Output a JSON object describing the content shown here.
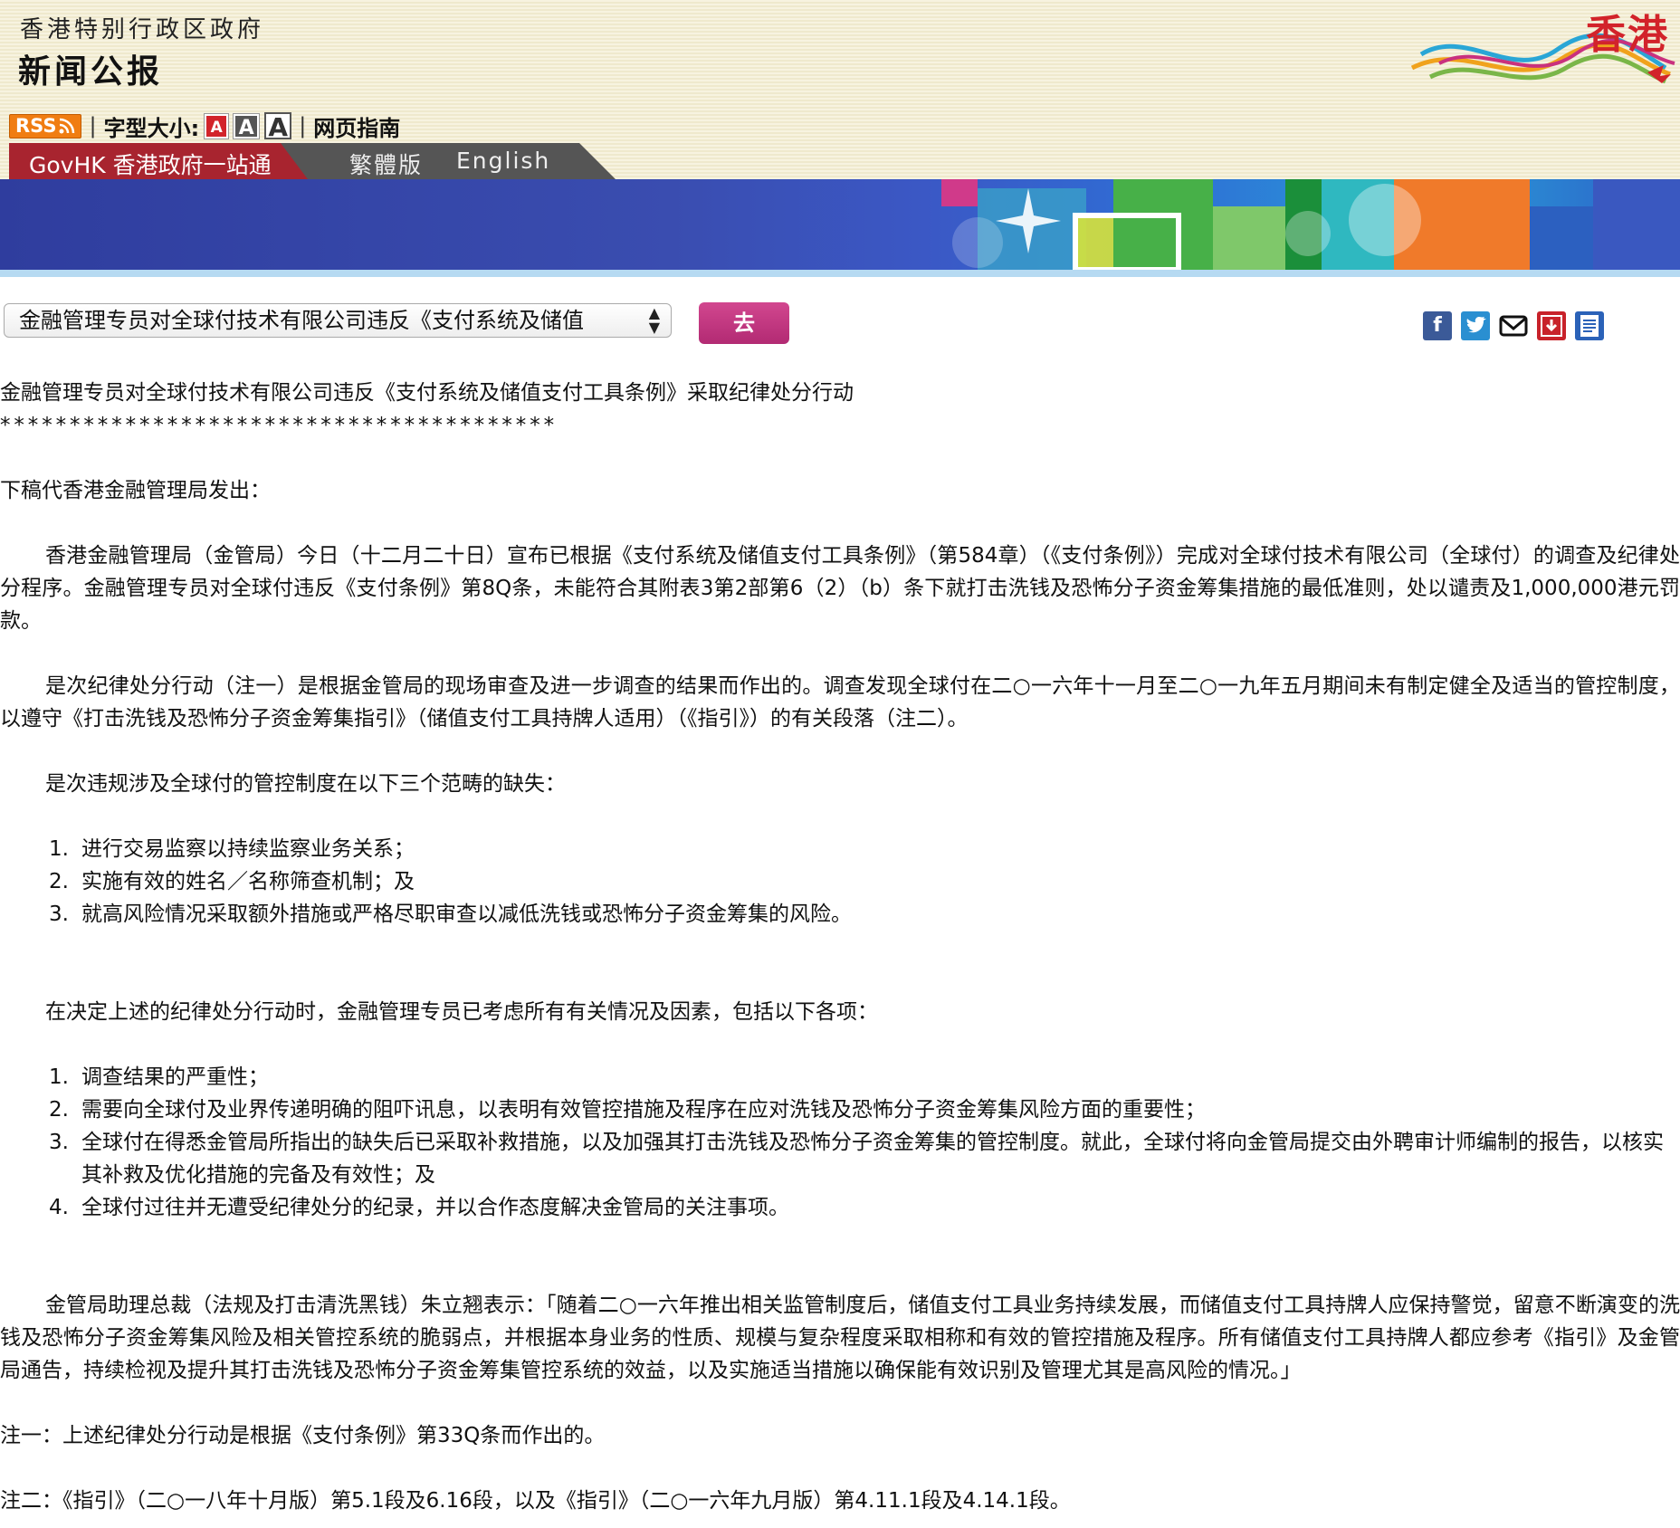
{
  "header": {
    "gov_name": "香港特别行政区政府",
    "press_title": "新闻公报",
    "brand": "香港",
    "rss_label": "RSS",
    "font_size_label": "字型大小:",
    "font_sizes": [
      "A",
      "A",
      "A"
    ],
    "guide_label": "网页指南"
  },
  "nav": {
    "govhk": "GovHK 香港政府一站通",
    "traditional": "繁體版",
    "english": "English"
  },
  "controls": {
    "select_value": "金融管理专员对全球付技术有限公司违反《支付系统及储值",
    "go_label": "去"
  },
  "share_icons": [
    "facebook-icon",
    "twitter-icon",
    "email-icon",
    "download-icon",
    "print-icon"
  ],
  "article": {
    "title": "金融管理专员对全球付技术有限公司违反《支付系统及储值支付工具条例》采取纪律处分行动",
    "stars": "****************************************",
    "intro": "下稿代香港金融管理局发出：",
    "p1": "香港金融管理局（金管局）今日（十二月二十日）宣布已根据《支付系统及储值支付工具条例》（第584章）（《支付条例》）完成对全球付技术有限公司（全球付）的调查及纪律处分程序。金融管理专员对全球付违反《支付条例》第8Q条，未能符合其附表3第2部第6（2）（b）条下就打击洗钱及恐怖分子资金筹集措施的最低准则，处以谴责及1,000,000港元罚款。",
    "p2": "是次纪律处分行动（注一）是根据金管局的现场审查及进一步调查的结果而作出的。调查发现全球付在二○一六年十一月至二○一九年五月期间未有制定健全及适当的管控制度，以遵守《打击洗钱及恐怖分子资金筹集指引》（储值支付工具持牌人适用）（《指引》）的有关段落（注二）。",
    "p3": "是次违规涉及全球付的管控制度在以下三个范畴的缺失：",
    "list1": [
      {
        "num": "1.",
        "text": "进行交易监察以持续监察业务关系；"
      },
      {
        "num": "2.",
        "text": "实施有效的姓名／名称筛查机制；及"
      },
      {
        "num": "3.",
        "text": "就高风险情况采取额外措施或严格尽职审查以减低洗钱或恐怖分子资金筹集的风险。"
      }
    ],
    "p4": "在决定上述的纪律处分行动时，金融管理专员已考虑所有有关情况及因素，包括以下各项：",
    "list2": [
      {
        "num": "1.",
        "text": "调查结果的严重性；"
      },
      {
        "num": "2.",
        "text": "需要向全球付及业界传递明确的阻吓讯息，以表明有效管控措施及程序在应对洗钱及恐怖分子资金筹集风险方面的重要性；"
      },
      {
        "num": "3.",
        "text": "全球付在得悉金管局所指出的缺失后已采取补救措施，以及加强其打击洗钱及恐怖分子资金筹集的管控制度。就此，全球付将向金管局提交由外聘审计师编制的报告，以核实其补救及优化措施的完备及有效性；及"
      },
      {
        "num": "4.",
        "text": "全球付过往并无遭受纪律处分的纪录，并以合作态度解决金管局的关注事项。"
      }
    ],
    "p5": "金管局助理总裁（法规及打击清洗黑钱）朱立翘表示：「随着二○一六年推出相关监管制度后，储值支付工具业务持续发展，而储值支付工具持牌人应保持警觉，留意不断演变的洗钱及恐怖分子资金筹集风险及相关管控系统的脆弱点，并根据本身业务的性质、规模与复杂程度采取相称和有效的管控措施及程序。所有储值支付工具持牌人都应参考《指引》及金管局通告，持续检视及提升其打击洗钱及恐怖分子资金筹集管控系统的效益，以及实施适当措施以确保能有效识别及管理尤其是高风险的情况。」",
    "note1": "注一：上述纪律处分行动是根据《支付条例》第33Q条而作出的。",
    "note2": "注二：《指引》（二○一八年十月版）第5.1段及6.16段，以及《指引》（二○一六年九月版）第4.11.1段及4.14.1段。"
  }
}
